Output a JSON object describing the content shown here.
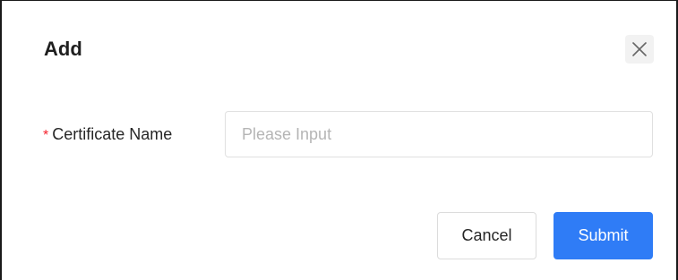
{
  "dialog": {
    "title": "Add",
    "close_icon": "close-icon"
  },
  "form": {
    "field_label": "Certificate Name",
    "required_mark": "*",
    "input_value": "",
    "input_placeholder": "Please Input"
  },
  "footer": {
    "cancel_label": "Cancel",
    "submit_label": "Submit"
  },
  "colors": {
    "primary": "#2f7cf6",
    "required": "#f5222d",
    "placeholder": "#b5b5b5"
  }
}
